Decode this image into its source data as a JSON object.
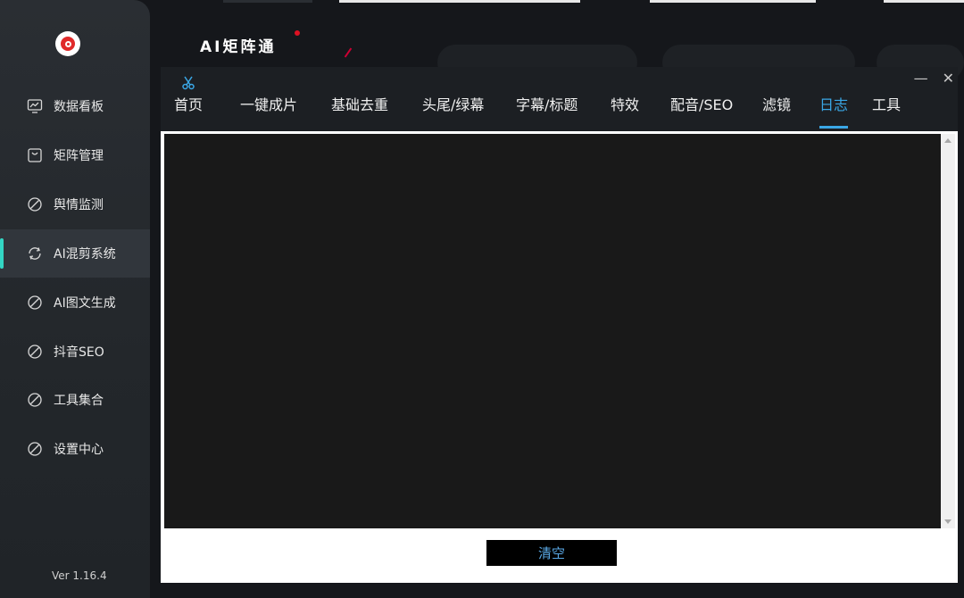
{
  "app": {
    "brand": "AI矩阵通",
    "version": "Ver 1.16.4"
  },
  "sidebar": {
    "items": [
      {
        "label": "数据看板",
        "icon": "dashboard-chart-icon",
        "active": false
      },
      {
        "label": "矩阵管理",
        "icon": "bag-icon",
        "active": false
      },
      {
        "label": "舆情监测",
        "icon": "circle-slash-icon",
        "active": false
      },
      {
        "label": "AI混剪系统",
        "icon": "refresh-cycle-icon",
        "active": true
      },
      {
        "label": "AI图文生成",
        "icon": "circle-slash-icon",
        "active": false
      },
      {
        "label": "抖音SEO",
        "icon": "circle-slash-icon",
        "active": false
      },
      {
        "label": "工具集合",
        "icon": "circle-slash-icon",
        "active": false
      },
      {
        "label": "设置中心",
        "icon": "circle-slash-icon",
        "active": false
      }
    ],
    "accent_color": "#33d6c4"
  },
  "dialog": {
    "icon": "scissors-icon",
    "minimize_glyph": "—",
    "close_glyph": "✕",
    "tabs": [
      {
        "label": "首页",
        "active": false
      },
      {
        "label": "一键成片",
        "active": false
      },
      {
        "label": "基础去重",
        "active": false
      },
      {
        "label": "头尾/绿幕",
        "active": false
      },
      {
        "label": "字幕/标题",
        "active": false
      },
      {
        "label": "特效",
        "active": false
      },
      {
        "label": "配音/SEO",
        "active": false
      },
      {
        "label": "滤镜",
        "active": false
      },
      {
        "label": "日志",
        "active": true
      },
      {
        "label": "工具",
        "active": false
      }
    ],
    "active_tab_color": "#3aa7e6",
    "log_text": "",
    "clear_button": "清空"
  }
}
